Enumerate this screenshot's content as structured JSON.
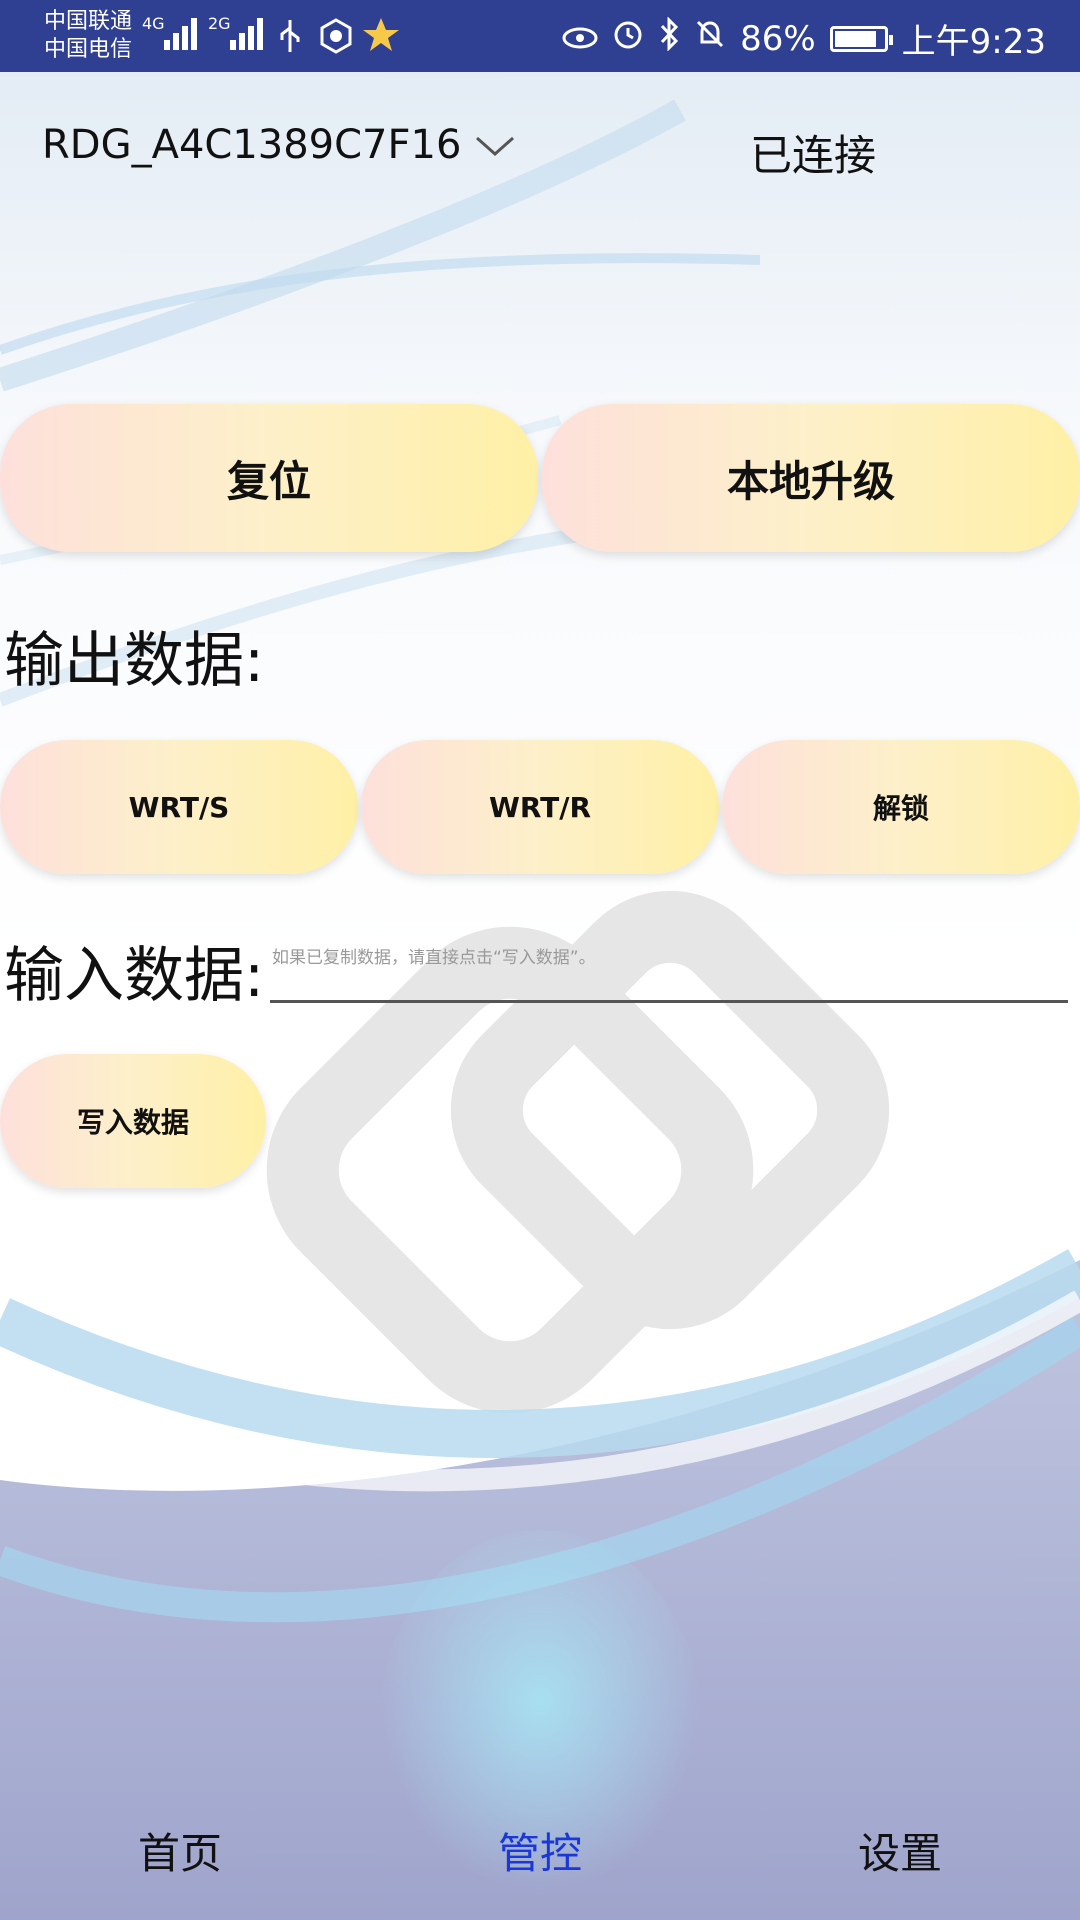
{
  "status_bar": {
    "carrier_1": "中国联通",
    "carrier_2": "中国电信",
    "net_1": "4G",
    "net_2": "2G",
    "battery_level": 0.86,
    "battery_text": "86%",
    "time": "上午9:23",
    "icons": [
      "signal-icon",
      "usb-icon",
      "hand-icon",
      "star-badge-icon",
      "eye-icon",
      "alarm-icon",
      "bluetooth-icon",
      "mute-icon",
      "battery-icon"
    ]
  },
  "device": {
    "name": "RDG_A4C1389C7F16",
    "status": "已连接"
  },
  "actions": {
    "reset": "复位",
    "local_upgrade": "本地升级"
  },
  "output": {
    "label": "输出数据:",
    "buttons": [
      "WRT/S",
      "WRT/R",
      "解锁"
    ]
  },
  "input": {
    "label": "输入数据:",
    "placeholder": "如果已复制数据，请直接点击“写入数据”。",
    "value": ""
  },
  "write_button": "写入数据",
  "nav": {
    "items": [
      "首页",
      "管控",
      "设置"
    ],
    "active_index": 1
  },
  "colors": {
    "status_bar": "#2f3f92",
    "accent": "#1a38d8",
    "button_gradient_start": "#fde0db",
    "button_gradient_end": "#fff0a6"
  }
}
